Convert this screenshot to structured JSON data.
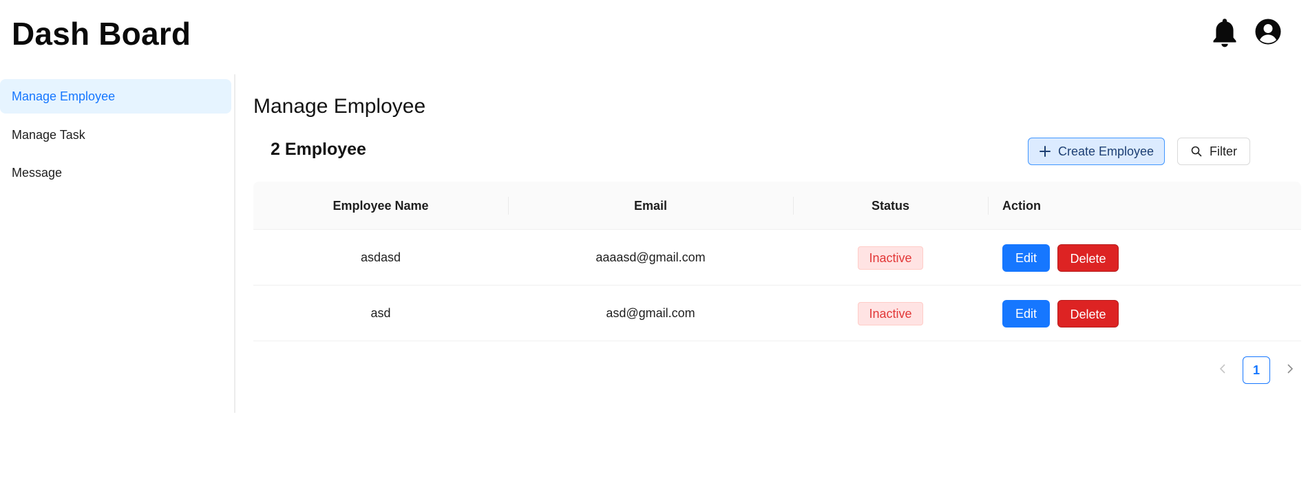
{
  "header": {
    "title": "Dash Board",
    "icons": [
      "bell-icon",
      "user-circle-icon"
    ]
  },
  "sidebar": {
    "items": [
      {
        "label": "Manage Employee",
        "active": true
      },
      {
        "label": "Manage Task",
        "active": false
      },
      {
        "label": "Message",
        "active": false
      }
    ]
  },
  "main": {
    "title": "Manage Employee",
    "count_label": "2 Employee",
    "create_button": "Create Employee",
    "filter_button": "Filter"
  },
  "table": {
    "columns": [
      "Employee Name",
      "Email",
      "Status",
      "Action"
    ],
    "rows": [
      {
        "name": "asdasd",
        "email": "aaaasd@gmail.com",
        "status": "Inactive",
        "edit": "Edit",
        "delete": "Delete"
      },
      {
        "name": "asd",
        "email": "asd@gmail.com",
        "status": "Inactive",
        "edit": "Edit",
        "delete": "Delete"
      }
    ]
  },
  "pagination": {
    "current_page": "1"
  },
  "colors": {
    "accent": "#1677ff",
    "danger": "#dd2323",
    "active_bg": "#e6f4ff"
  }
}
